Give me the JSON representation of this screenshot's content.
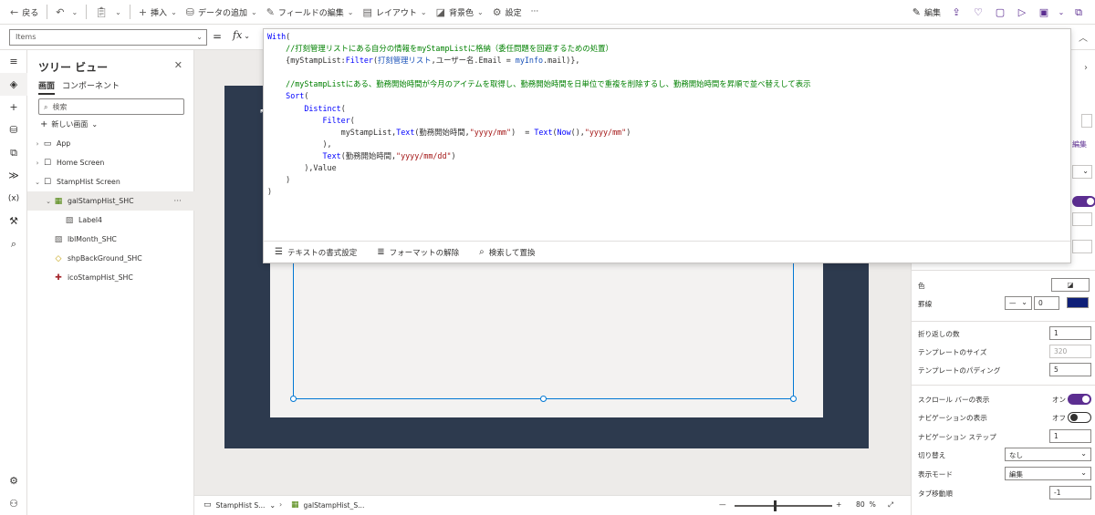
{
  "toolbar": {
    "back": "戻る",
    "insert": "挿入",
    "add_data": "データの追加",
    "edit_fields": "フィールドの編集",
    "layout": "レイアウト",
    "background": "背景色",
    "settings": "設定",
    "more": "···",
    "edit": "編集"
  },
  "formula_bar": {
    "property": "Items",
    "equals": "=",
    "fx": "fx"
  },
  "editor": {
    "lines": [
      [
        {
          "t": "kw",
          "v": "With"
        },
        {
          "t": "",
          "v": "("
        }
      ],
      [
        {
          "t": "",
          "v": "    "
        },
        {
          "t": "cm",
          "v": "//打刻管理リストにある自分の情報をmyStampListに格納（委任問題を回避するための処置）"
        }
      ],
      [
        {
          "t": "",
          "v": "    {myStampList:"
        },
        {
          "t": "kw",
          "v": "Filter"
        },
        {
          "t": "",
          "v": "("
        },
        {
          "t": "vr",
          "v": "打刻管理リスト"
        },
        {
          "t": "",
          "v": ",ユーザー名.Email = "
        },
        {
          "t": "vr",
          "v": "myInfo"
        },
        {
          "t": "",
          "v": ".mail)},"
        }
      ],
      [
        {
          "t": "",
          "v": ""
        }
      ],
      [
        {
          "t": "",
          "v": "    "
        },
        {
          "t": "cm",
          "v": "//myStampListにある、勤務開始時間が今月のアイテムを取得し、勤務開始時間を日単位で重複を削除するし、勤務開始時間を昇順で並べ替えして表示"
        }
      ],
      [
        {
          "t": "",
          "v": "    "
        },
        {
          "t": "kw",
          "v": "Sort"
        },
        {
          "t": "",
          "v": "("
        }
      ],
      [
        {
          "t": "",
          "v": "        "
        },
        {
          "t": "kw",
          "v": "Distinct"
        },
        {
          "t": "",
          "v": "("
        }
      ],
      [
        {
          "t": "",
          "v": "            "
        },
        {
          "t": "kw",
          "v": "Filter"
        },
        {
          "t": "",
          "v": "("
        }
      ],
      [
        {
          "t": "",
          "v": "                myStampList,"
        },
        {
          "t": "kw",
          "v": "Text"
        },
        {
          "t": "",
          "v": "(勤務開始時間,"
        },
        {
          "t": "st",
          "v": "\"yyyy/mm\""
        },
        {
          "t": "",
          "v": ")  = "
        },
        {
          "t": "kw",
          "v": "Text"
        },
        {
          "t": "",
          "v": "("
        },
        {
          "t": "kw",
          "v": "Now"
        },
        {
          "t": "",
          "v": "(),"
        },
        {
          "t": "st",
          "v": "\"yyyy/mm\""
        },
        {
          "t": "",
          "v": ")"
        }
      ],
      [
        {
          "t": "",
          "v": "            ),"
        }
      ],
      [
        {
          "t": "",
          "v": "            "
        },
        {
          "t": "kw",
          "v": "Text"
        },
        {
          "t": "",
          "v": "(勤務開始時間,"
        },
        {
          "t": "st",
          "v": "\"yyyy/mm/dd\""
        },
        {
          "t": "",
          "v": ")"
        }
      ],
      [
        {
          "t": "",
          "v": "        ),Value"
        }
      ],
      [
        {
          "t": "",
          "v": "    )"
        }
      ],
      [
        {
          "t": "",
          "v": ")"
        }
      ]
    ],
    "footer": {
      "format_text": "テキストの書式設定",
      "remove_format": "フォーマットの解除",
      "find_replace": "検索して置換"
    }
  },
  "tree": {
    "title": "ツリー ビュー",
    "tab_screens": "画面",
    "tab_components": "コンポーネント",
    "search_placeholder": "検索",
    "new_screen": "新しい画面",
    "items": [
      {
        "label": "App",
        "level": 0,
        "exp": "›",
        "icon": "▭"
      },
      {
        "label": "Home Screen",
        "level": 0,
        "exp": "›",
        "icon": "☐"
      },
      {
        "label": "StampHist Screen",
        "level": 0,
        "exp": "⌄",
        "icon": "☐"
      },
      {
        "label": "galStampHist_SHC",
        "level": 1,
        "exp": "⌄",
        "icon": "▦"
      },
      {
        "label": "Label4",
        "level": 2,
        "exp": "",
        "icon": "▧"
      },
      {
        "label": "lblMonth_SHC",
        "level": 1,
        "exp": "",
        "icon": "▧"
      },
      {
        "label": "shpBackGround_SHC",
        "level": 1,
        "exp": "",
        "icon": "◇"
      },
      {
        "label": "icoStampHist_SHC",
        "level": 1,
        "exp": "",
        "icon": "✚"
      }
    ]
  },
  "props": {
    "color_label": "色",
    "border_label": "罫線",
    "border_width": "0",
    "border_color": "#0f1f78",
    "wrap_count_label": "折り返しの数",
    "wrap_count": "1",
    "template_size_label": "テンプレートのサイズ",
    "template_size": "320",
    "template_padding_label": "テンプレートのパディング",
    "template_padding": "5",
    "show_scrollbar_label": "スクロール バーの表示",
    "show_scrollbar_state": "オン",
    "show_nav_label": "ナビゲーションの表示",
    "show_nav_state": "オフ",
    "nav_step_label": "ナビゲーション ステップ",
    "nav_step": "1",
    "transition_label": "切り替え",
    "transition": "なし",
    "display_mode_label": "表示モード",
    "display_mode": "編集",
    "tab_index_label": "タブ移動順",
    "tab_index": "-1",
    "edit_link": "編集"
  },
  "status": {
    "screen": "StampHist S...",
    "control": "galStampHist_S...",
    "zoom": "80",
    "zoom_unit": "%",
    "zoom_fraction": 0.4
  }
}
